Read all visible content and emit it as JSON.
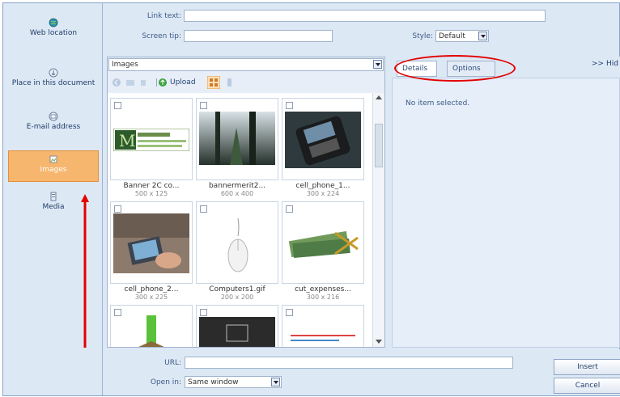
{
  "top": {
    "link_text_label": "Link text:",
    "screen_tip_label": "Screen tip:",
    "style_label": "Style:",
    "style_value": "Default"
  },
  "nav": {
    "items": [
      {
        "label": "Web location",
        "icon": "globe-icon"
      },
      {
        "label": "Place in this document",
        "icon": "anchor-icon"
      },
      {
        "label": "E-mail address",
        "icon": "email-icon"
      },
      {
        "label": "Images",
        "icon": "image-icon"
      },
      {
        "label": "Media",
        "icon": "media-icon"
      }
    ]
  },
  "images": {
    "folder": "Images",
    "upload_label": "Upload",
    "thumbnails": [
      {
        "name": "Banner 2C co...",
        "dims": "500 x 125"
      },
      {
        "name": "bannermerit2...",
        "dims": "600 x 400"
      },
      {
        "name": "cell_phone_1...",
        "dims": "300 x 224"
      },
      {
        "name": "cell_phone_2...",
        "dims": "300 x 225"
      },
      {
        "name": "Computers1.gif",
        "dims": "200 x 200"
      },
      {
        "name": "cut_expenses...",
        "dims": "300 x 216"
      }
    ]
  },
  "details": {
    "tab_details": "Details",
    "tab_options": "Options",
    "hide_label": ">> Hid",
    "empty_message": "No item selected."
  },
  "bottom": {
    "url_label": "URL:",
    "open_in_label": "Open in:",
    "open_in_value": "Same window",
    "insert_label": "Insert",
    "cancel_label": "Cancel"
  },
  "colors": {
    "accent": "#f7b66d",
    "annotation_red": "#e30000",
    "panel_bg": "#dde8f5"
  }
}
